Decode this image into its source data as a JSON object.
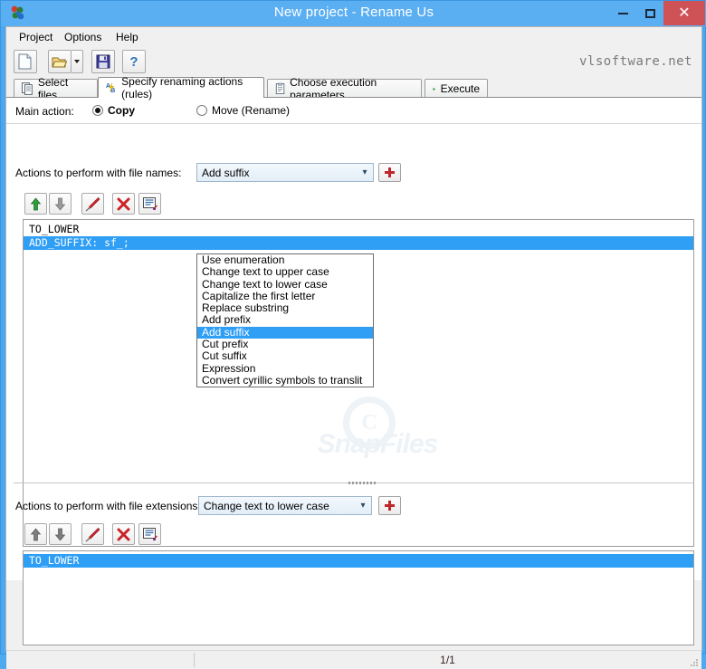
{
  "window": {
    "title": "New project - Rename Us",
    "app_icon": "app-icon",
    "minimize_label": "Minimize",
    "maximize_label": "Maximize",
    "close_label": "Close",
    "close_color": "#cf5257",
    "titlebar_color": "#5aaef2"
  },
  "menubar": {
    "items": [
      {
        "label": "Project"
      },
      {
        "label": "Options"
      },
      {
        "label": "Help"
      }
    ]
  },
  "toolbar": {
    "buttons": [
      {
        "name": "new-project-button",
        "icon": "new-document-icon"
      },
      {
        "name": "open-project-button",
        "icon": "open-folder-icon"
      },
      {
        "name": "save-project-button",
        "icon": "save-floppy-icon"
      },
      {
        "name": "help-button",
        "icon": "question-mark-icon"
      }
    ],
    "brand": "vlsoftware.net"
  },
  "tabs": [
    {
      "label": "Select files",
      "icon": "files-icon",
      "active": false
    },
    {
      "label": "Specify renaming actions (rules)",
      "icon": "ab-icon",
      "active": true
    },
    {
      "label": "Choose execution parameters",
      "icon": "parameters-icon",
      "active": false
    },
    {
      "label": "Execute",
      "icon": "play-icon",
      "active": false
    }
  ],
  "main_action": {
    "label": "Main action:",
    "options": [
      {
        "label": "Copy",
        "checked": true
      },
      {
        "label": "Move (Rename)",
        "checked": false
      }
    ]
  },
  "filenames_section": {
    "label": "Actions to perform with file names:",
    "combo_value": "Add suffix",
    "add_button_label": "+",
    "list_tools": [
      {
        "name": "move-up-button",
        "icon": "arrow-up-icon"
      },
      {
        "name": "move-down-button",
        "icon": "arrow-down-icon"
      },
      {
        "name": "edit-rule-button",
        "icon": "pen-icon"
      },
      {
        "name": "delete-rule-button",
        "icon": "red-x-icon"
      },
      {
        "name": "edit-list-button",
        "icon": "edit-list-icon"
      }
    ],
    "rules": [
      {
        "text": "TO_LOWER",
        "selected": false
      },
      {
        "text": "ADD_SUFFIX: sf_;",
        "selected": true
      }
    ]
  },
  "dropdown": {
    "open": true,
    "selected": "Add suffix",
    "options": [
      "Use enumeration",
      "Change text to upper case",
      "Change text to lower case",
      "Capitalize the first letter",
      "Replace substring",
      "Add prefix",
      "Add suffix",
      "Cut prefix",
      "Cut suffix",
      "Expression",
      "Convert cyrillic symbols to translit"
    ]
  },
  "extensions_section": {
    "label": "Actions to perform with file extensions:",
    "combo_value": "Change text to lower case",
    "add_button_label": "+",
    "list_tools": [
      {
        "name": "move-up-button",
        "icon": "arrow-up-icon"
      },
      {
        "name": "move-down-button",
        "icon": "arrow-down-icon"
      },
      {
        "name": "edit-rule-button",
        "icon": "pen-icon"
      },
      {
        "name": "delete-rule-button",
        "icon": "red-x-icon"
      },
      {
        "name": "edit-list-button",
        "icon": "edit-list-icon"
      }
    ],
    "rules": [
      {
        "text": "TO_LOWER",
        "selected": true
      }
    ]
  },
  "statusbar": {
    "left": "",
    "count": "1/1"
  },
  "watermark": {
    "copyright": "C",
    "text": "SnapFiles"
  },
  "colors": {
    "selection": "#2f9ef5",
    "accent_red": "#c0272d",
    "window_blue": "#4da6f0"
  }
}
